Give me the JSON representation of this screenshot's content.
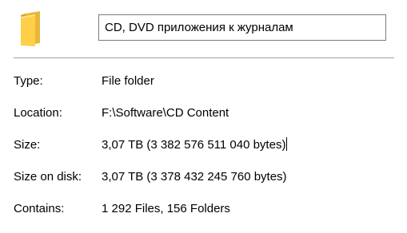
{
  "header": {
    "folder_icon": "folder-icon",
    "name_value": "CD, DVD приложения к журналам"
  },
  "properties": {
    "type": {
      "label": "Type:",
      "value": "File folder"
    },
    "location": {
      "label": "Location:",
      "value": "F:\\Software\\CD Content"
    },
    "size": {
      "label": "Size:",
      "value": "3,07 TB (3 382 576 511 040 bytes)"
    },
    "size_on_disk": {
      "label": "Size on disk:",
      "value": "3,07 TB (3 378 432 245 760 bytes)"
    },
    "contains": {
      "label": "Contains:",
      "value": "1 292 Files, 156 Folders"
    }
  },
  "colors": {
    "folder_front": "#ffcf48",
    "folder_back": "#e8b73a",
    "border": "#7a7a7a",
    "separator": "#a0a0a0"
  }
}
